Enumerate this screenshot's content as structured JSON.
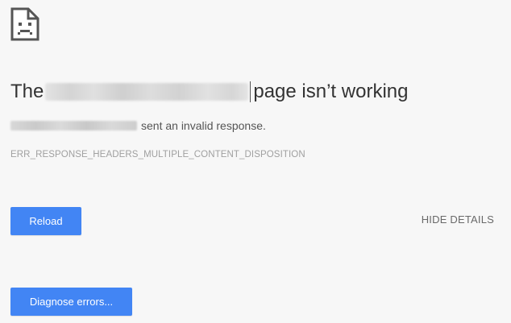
{
  "error": {
    "icon": "sad-page-icon",
    "heading_prefix": "The",
    "heading_suffix": "page isn’t working",
    "summary_suffix": "sent an invalid response.",
    "code": "ERR_RESPONSE_HEADERS_MULTIPLE_CONTENT_DISPOSITION"
  },
  "actions": {
    "reload_label": "Reload",
    "details_label": "HIDE DETAILS",
    "diagnose_label": "Diagnose errors..."
  },
  "colors": {
    "background": "#f7f7f7",
    "button": "#4285f4",
    "heading": "#333333",
    "error_code": "#a0a0a0"
  }
}
